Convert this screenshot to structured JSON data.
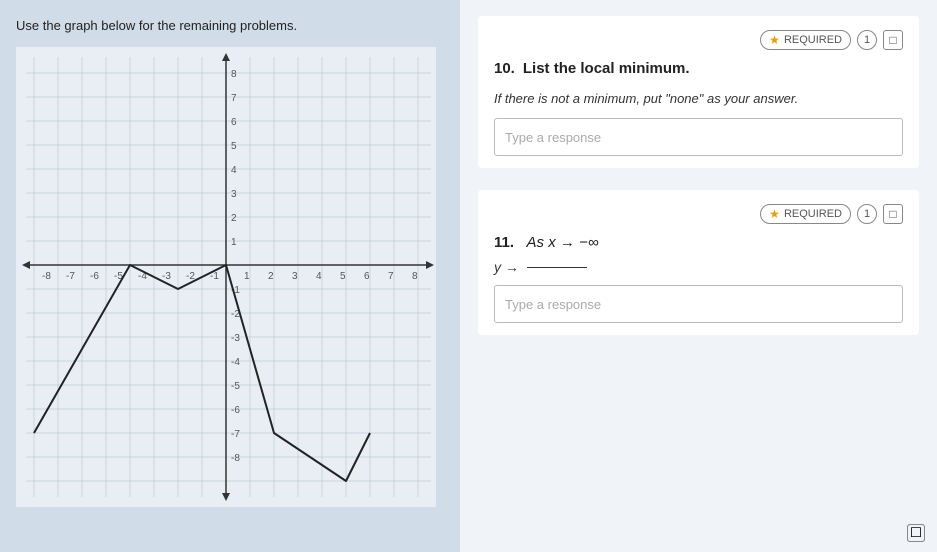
{
  "left": {
    "instruction": "Use the graph below for the remaining problems."
  },
  "right": {
    "q10": {
      "number": "10.",
      "title": "List the local minimum.",
      "body": "If there is not a minimum, put \"none\" as your answer.",
      "placeholder": "Type a response",
      "required_label": "REQUIRED",
      "step": "1"
    },
    "q11": {
      "number": "11.",
      "label_text": "As x → −∞",
      "arrow_label": "y →",
      "placeholder": "Type a response",
      "required_label": "REQUIRED",
      "step": "1"
    }
  },
  "colors": {
    "accent": "#e8a000",
    "border": "#bbbbbb",
    "text_main": "#222222"
  }
}
